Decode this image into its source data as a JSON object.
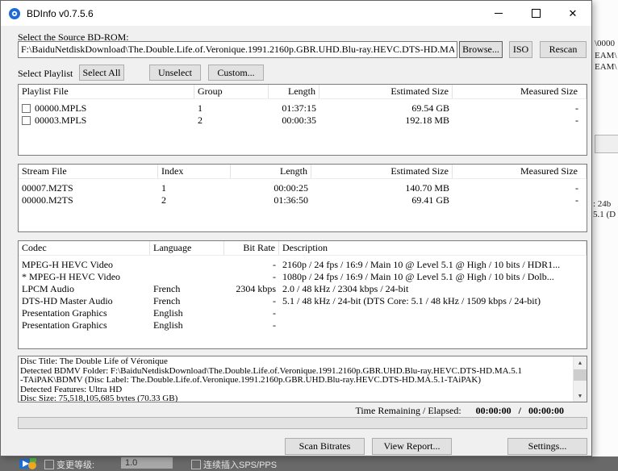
{
  "window": {
    "title": "BDInfo v0.7.5.6"
  },
  "source": {
    "label": "Select the Source BD-ROM:",
    "path": "F:\\BaiduNetdiskDownload\\The.Double.Life.of.Veronique.1991.2160p.GBR.UHD.Blu-ray.HEVC.DTS-HD.MA.",
    "browse_label": "Browse...",
    "iso_label": "ISO",
    "rescan_label": "Rescan"
  },
  "playlist_bar": {
    "label": "Select Playlist",
    "select_all": "Select All",
    "unselect": "Unselect",
    "custom": "Custom..."
  },
  "playlist_table": {
    "headers": [
      "Playlist File",
      "Group",
      "Length",
      "Estimated Size",
      "Measured Size"
    ],
    "rows": [
      {
        "file": "00000.MPLS",
        "group": "1",
        "length": "01:37:15",
        "estimated": "69.54 GB",
        "measured": "-"
      },
      {
        "file": "00003.MPLS",
        "group": "2",
        "length": "00:00:35",
        "estimated": "192.18 MB",
        "measured": "-"
      }
    ]
  },
  "stream_table": {
    "headers": [
      "Stream File",
      "Index",
      "Length",
      "Estimated Size",
      "Measured Size"
    ],
    "rows": [
      {
        "file": "00007.M2TS",
        "index": "1",
        "length": "00:00:25",
        "estimated": "140.70 MB",
        "measured": "-"
      },
      {
        "file": "00000.M2TS",
        "index": "2",
        "length": "01:36:50",
        "estimated": "69.41 GB",
        "measured": "-"
      }
    ]
  },
  "codec_table": {
    "headers": [
      "Codec",
      "Language",
      "Bit Rate",
      "Description"
    ],
    "rows": [
      {
        "codec": "MPEG-H HEVC Video",
        "language": "",
        "bit_rate": "-",
        "description": "2160p / 24 fps / 16:9 / Main 10 @ Level 5.1 @ High / 10 bits / HDR1..."
      },
      {
        "codec": "* MPEG-H HEVC Video",
        "language": "",
        "bit_rate": "-",
        "description": "1080p / 24 fps / 16:9 / Main 10 @ Level 5.1 @ High / 10 bits / Dolb..."
      },
      {
        "codec": "LPCM Audio",
        "language": "French",
        "bit_rate": "2304 kbps",
        "description": "2.0 / 48 kHz /  2304 kbps / 24-bit"
      },
      {
        "codec": "DTS-HD Master Audio",
        "language": "French",
        "bit_rate": "-",
        "description": "5.1 / 48 kHz / 24-bit (DTS Core: 5.1 / 48 kHz /  1509 kbps / 24-bit)"
      },
      {
        "codec": "Presentation Graphics",
        "language": "English",
        "bit_rate": "-",
        "description": ""
      },
      {
        "codec": "Presentation Graphics",
        "language": "English",
        "bit_rate": "-",
        "description": ""
      }
    ]
  },
  "log": {
    "lines": [
      "Disc Title: The Double Life of Véronique",
      "Detected BDMV Folder: F:\\BaiduNetdiskDownload\\The.Double.Life.of.Veronique.1991.2160p.GBR.UHD.Blu-ray.HEVC.DTS-HD.MA.5.1",
      "-TAiPAK\\BDMV (Disc Label: The.Double.Life.of.Veronique.1991.2160p.GBR.UHD.Blu-ray.HEVC.DTS-HD.MA.5.1-TAiPAK)",
      "Detected Features: Ultra HD",
      "Disc Size: 75,518,105,685 bytes (70.33 GB)"
    ]
  },
  "status": {
    "time_label": "Time Remaining / Elapsed:",
    "remaining": "00:00:00",
    "separator": "/",
    "elapsed": "00:00:00"
  },
  "actions": {
    "scan": "Scan Bitrates",
    "view_report": "View Report...",
    "settings": "Settings..."
  },
  "background": {
    "right_fragments": [
      "\\0000",
      "EAM\\",
      "EAM\\",
      ": 24b",
      "5.1 (D"
    ],
    "taskbar": {
      "level_label": "变更等级:",
      "level_value": "1.0",
      "sps_label": "连续插入SPS/PPS"
    }
  }
}
